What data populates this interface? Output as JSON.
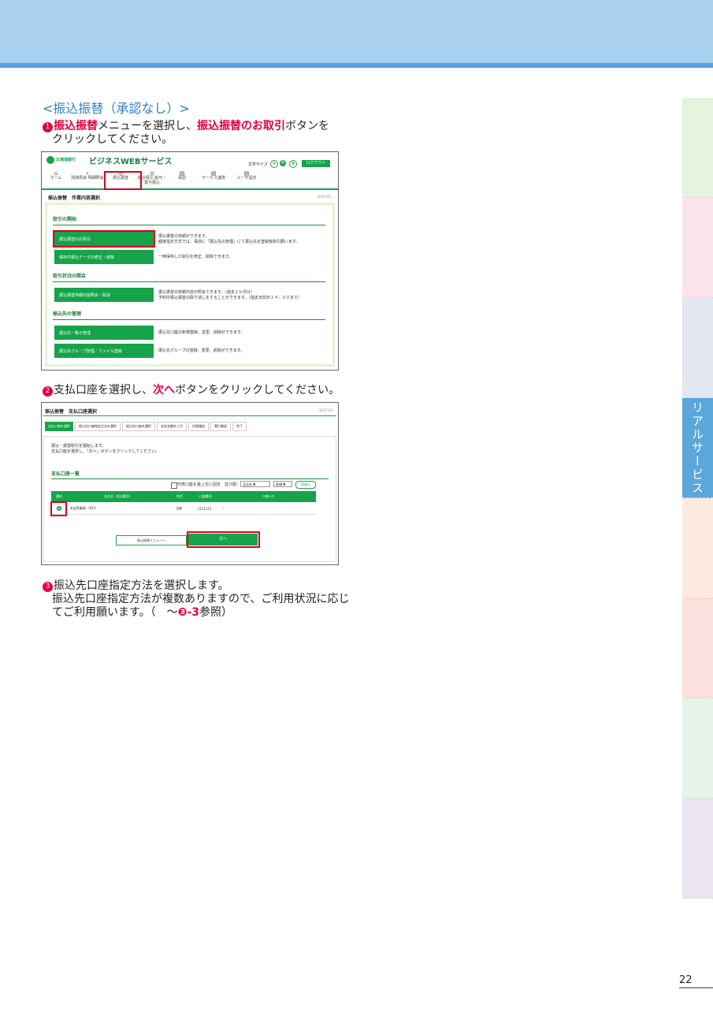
{
  "section_title": "<振込振替（承認なし）>",
  "step1": {
    "num": "❶",
    "pre": "振込振替",
    "mid": "メニューを選択し、",
    "hl": "振込振替のお取引",
    "post": "ボタンを",
    "line2": "クリックしてください。"
  },
  "step2": {
    "num": "❷",
    "pre": "支払口座を選択し、",
    "hl": "次へ",
    "post": "ボタンをクリックしてください。"
  },
  "step3": {
    "num": "❸",
    "line1": "振込先口座指定方法を選択します。",
    "line2": "振込先口座指定方法が複数ありますので、ご利用状況に応じ",
    "line3_pre": "てご利用願います。（　～",
    "line3_ref": "❸-3",
    "line3_post": "参照）"
  },
  "sidebar": {
    "active_label": "リアルサービス"
  },
  "page_number": "22",
  "colors": {
    "accent_blue": "#2f7fc6",
    "highlight_red": "#e5003f",
    "bank_green": "#16a34a"
  },
  "screen1": {
    "bank": "北海道銀行",
    "service": "ビジネスWEBサービス",
    "font_size_label": "文字サイズ",
    "font_sizes": [
      "小",
      "中",
      "大"
    ],
    "logout": "ログアウト",
    "nav": [
      "ホーム",
      "残高照会 明細照会",
      "振込振替",
      "総合振込 給与・賞与振込",
      "承認",
      "サービス連携",
      "ユーザ設定"
    ],
    "breadcrumb": "振込振替　作業内容選択",
    "screen_id": "BFKF001",
    "groups": [
      {
        "title": "取引の開始",
        "items": [
          {
            "button": "振込振替のお取引",
            "desc": "振込振替の依頼ができます。\n都度指定方式では、事前に「振込先の管理」にて振込先を登録後取引願います。"
          },
          {
            "button": "保存中振込データの修正・削除",
            "desc": "一時保存した取引を修正、削除できます。"
          }
        ]
      },
      {
        "title": "取引状況の照会",
        "items": [
          {
            "button": "振込振替依頼内容照会・取消",
            "desc": "振込振替の依頼内容が照会できます。（過去１か月分）\n予約中振込振替の取り消しをすることができます。（指定日前日２４：００まで）"
          }
        ]
      },
      {
        "title": "振込先の管理",
        "items": [
          {
            "button": "振込先一覧の管理",
            "desc": "振込先口座の新規登録、変更、削除ができます。"
          },
          {
            "button": "振込先グループ管理／ファイル登録",
            "desc": "振込先グループの登録、変更、削除ができます。"
          }
        ]
      }
    ]
  },
  "screen2": {
    "breadcrumb": "振込振替　支払口座選択",
    "screen_id": "BFKF002",
    "steps": [
      "支払口座を選択",
      "振込先口座指定方法を選択",
      "振込先口座を選択",
      "支払金額を入力",
      "内容確認",
      "実行確認",
      "完了"
    ],
    "intro1": "振込・振替取引を開始します。",
    "intro2": "支払口座を選択し、「次へ」ボタンをクリックしてください。",
    "list_title": "支払口座一覧",
    "rep_check": "代表口座を最上位に固定",
    "sort_label": "並び順：",
    "sort_value": "支店名",
    "order_value": "昇順",
    "redisplay": "再表示",
    "columns": [
      "選択",
      "支店名（支店番号）",
      "科目",
      "口座番号",
      "口座メモ"
    ],
    "row": {
      "branch": "本店営業部（101）",
      "type": "当座",
      "number": "1111111",
      "memo": "－"
    },
    "back_button": "振込振替メニューへ",
    "next_button": "次へ"
  }
}
